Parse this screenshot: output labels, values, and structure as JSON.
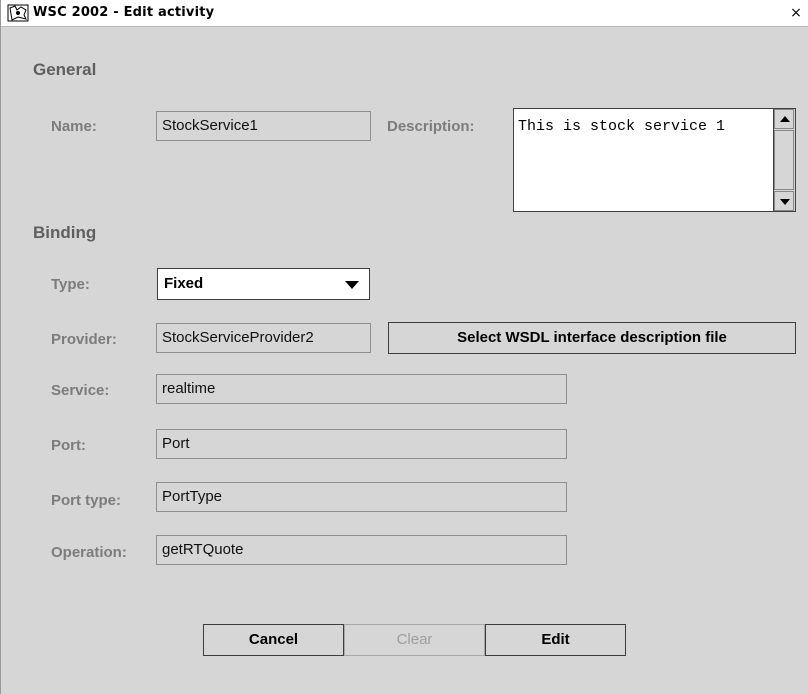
{
  "window": {
    "title": "WSC 2002 - Edit activity",
    "close_glyph": "×",
    "app_icon": "window-logo-icon"
  },
  "general": {
    "heading": "General",
    "name_label": "Name:",
    "name_value": "StockService1",
    "description_label": "Description:",
    "description_value": "This is stock service 1"
  },
  "binding": {
    "heading": "Binding",
    "type_label": "Type:",
    "type_value": "Fixed",
    "provider_label": "Provider:",
    "provider_value": "StockServiceProvider2",
    "select_wsdl_label": "Select WSDL interface description file",
    "service_label": "Service:",
    "service_value": "realtime",
    "port_label": "Port:",
    "port_value": "Port",
    "port_type_label": "Port type:",
    "port_type_value": "PortType",
    "operation_label": "Operation:",
    "operation_value": "getRTQuote"
  },
  "buttons": {
    "cancel": "Cancel",
    "clear": "Clear",
    "edit": "Edit"
  },
  "colors": {
    "window_bg": "#d6d6d6",
    "label": "#7c7c7c",
    "heading": "#5f5f5f"
  }
}
